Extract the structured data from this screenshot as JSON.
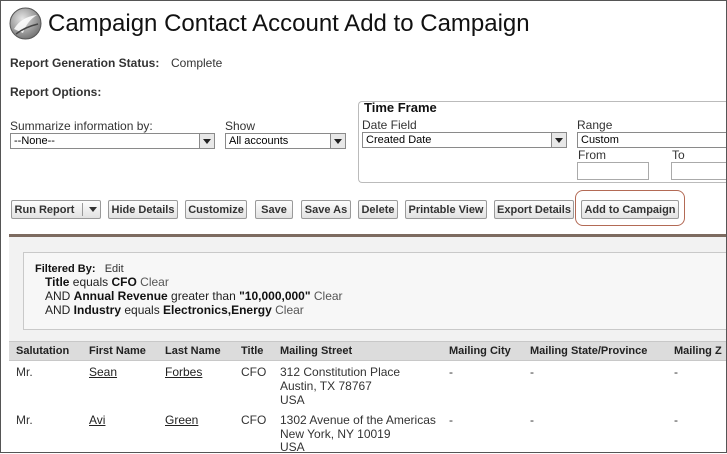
{
  "header": {
    "title": "Campaign Contact Account Add to Campaign",
    "logo_icon": "cloud-logo-icon"
  },
  "status": {
    "label": "Report Generation Status:",
    "value": "Complete"
  },
  "options": {
    "label": "Report Options:"
  },
  "summarize": {
    "label": "Summarize information by:",
    "value": "--None--"
  },
  "show": {
    "label": "Show",
    "value": "All accounts"
  },
  "timeframe": {
    "title": "Time Frame",
    "date_field_label": "Date Field",
    "date_field_value": "Created Date",
    "range_label": "Range",
    "range_value": "Custom",
    "from_label": "From",
    "to_label": "To"
  },
  "toolbar": {
    "run_report": "Run Report",
    "hide_details": "Hide Details",
    "customize": "Customize",
    "save": "Save",
    "save_as": "Save As",
    "delete": "Delete",
    "printable_view": "Printable View",
    "export_details": "Export Details",
    "add_to_campaign": "Add to Campaign"
  },
  "filters": {
    "label": "Filtered By:",
    "edit": "Edit",
    "clear": "Clear",
    "line1": {
      "field": "Title",
      "op": " equals ",
      "value": "CFO"
    },
    "line2": {
      "prefix": "AND ",
      "field": "Annual Revenue",
      "op": " greater than ",
      "value": "\"10,000,000\""
    },
    "line3": {
      "prefix": "AND ",
      "field": "Industry",
      "op": " equals ",
      "value": "Electronics,Energy"
    }
  },
  "table": {
    "columns": [
      "Salutation",
      "First Name",
      "Last Name",
      "Title",
      "Mailing Street",
      "Mailing City",
      "Mailing State/Province",
      "Mailing Z"
    ],
    "rows": [
      {
        "salutation": "Mr.",
        "first": "Sean",
        "last": "Forbes",
        "title": "CFO",
        "street1": "312 Constitution Place",
        "street2": "Austin, TX 78767",
        "street3": "USA",
        "city": "-",
        "state": "-",
        "zip": "-"
      },
      {
        "salutation": "Mr.",
        "first": "Avi",
        "last": "Green",
        "title": "CFO",
        "street1": "1302 Avenue of the Americas",
        "street2": "New York, NY 10019",
        "street3": "USA",
        "city": "-",
        "state": "-",
        "zip": "-"
      }
    ]
  },
  "colors": {
    "rule": "#7d6b60",
    "highlight": "#b36a55",
    "header_bg": "#dcdcdc"
  }
}
